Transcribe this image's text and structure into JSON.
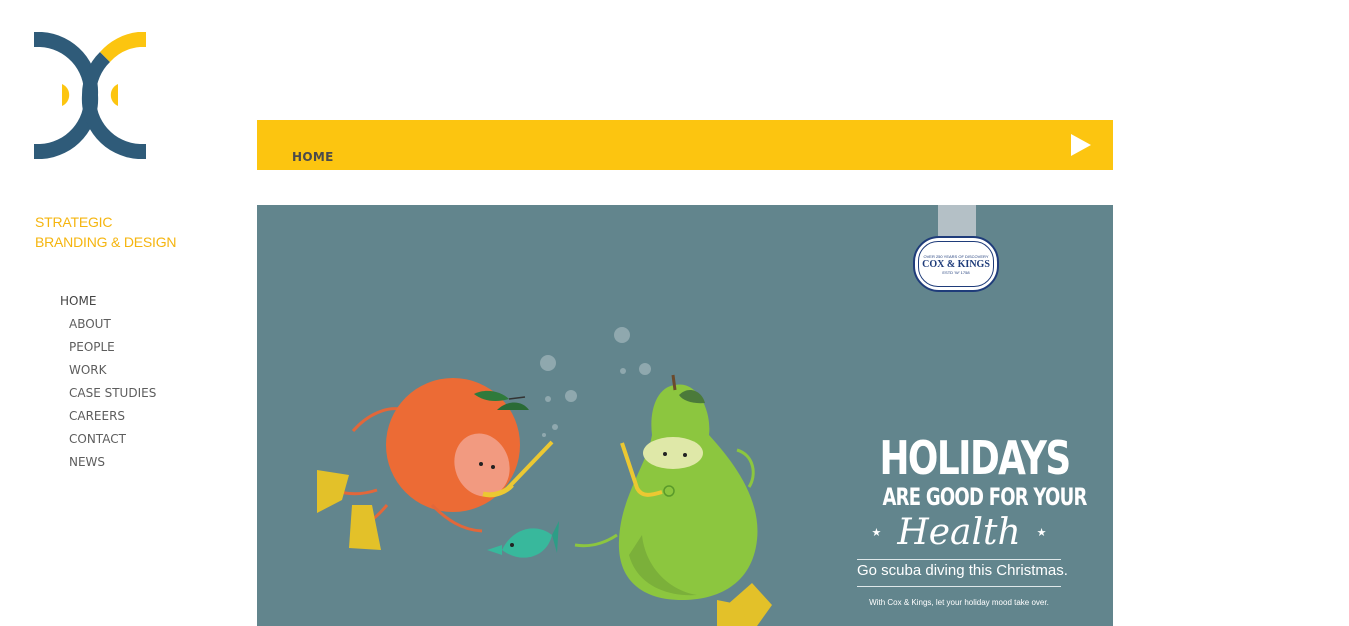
{
  "brand": {
    "tagline_line1": "STRATEGIC",
    "tagline_line2": "BRANDING & DESIGN",
    "colors": {
      "yellow": "#fcc510",
      "navy": "#2f5b79",
      "banner": "#62858d"
    }
  },
  "sidebar": {
    "items": [
      {
        "label": "HOME",
        "active": true
      },
      {
        "label": "ABOUT"
      },
      {
        "label": "PEOPLE"
      },
      {
        "label": "WORK"
      },
      {
        "label": "CASE STUDIES"
      },
      {
        "label": "CAREERS"
      },
      {
        "label": "CONTACT"
      },
      {
        "label": "NEWS"
      }
    ]
  },
  "topbar": {
    "breadcrumb": "HOME",
    "play_icon": "play-icon"
  },
  "banner": {
    "client_logo": {
      "name": "COX & KINGS",
      "arc_top": "OVER 250 YEARS OF DISCOVERY",
      "arc_bottom": "ESTD ’W’ 1758"
    },
    "headline": "HOLIDAYS",
    "subheadline": "ARE GOOD FOR YOUR",
    "script_word": "Health",
    "tagline": "Go scuba diving this Christmas.",
    "footnote": "With Cox & Kings, let your holiday mood take over."
  }
}
